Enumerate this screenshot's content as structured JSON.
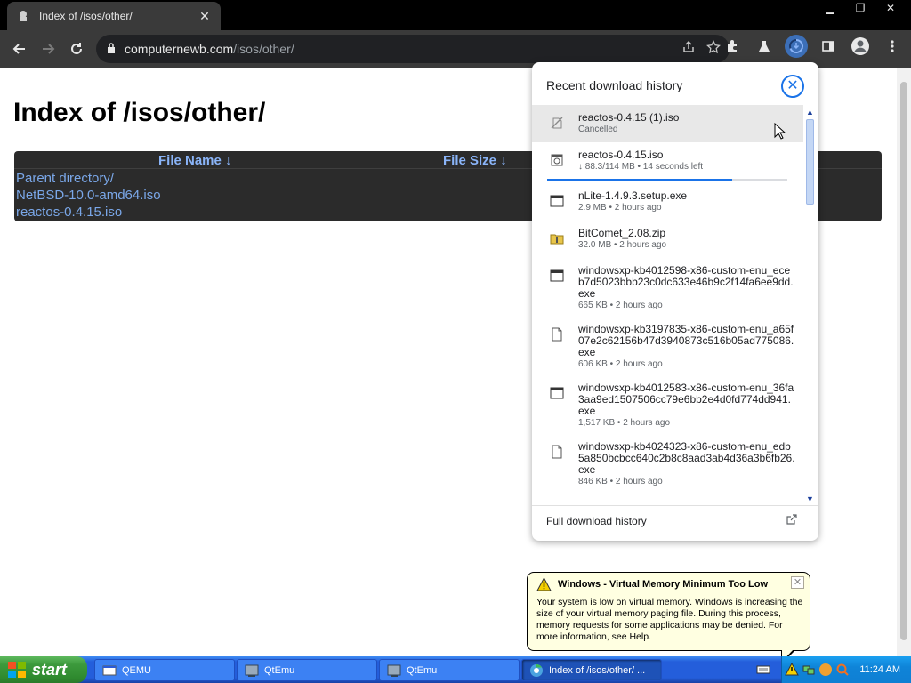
{
  "browser": {
    "tab_title": "Index of /isos/other/",
    "address_host": "computernewb.com",
    "address_path": "/isos/other/"
  },
  "page": {
    "heading": "Index of /isos/other/",
    "columns": [
      "File Name  ↓",
      "File Size  ↓"
    ],
    "entries": [
      "Parent directory/",
      "NetBSD-10.0-amd64.iso",
      "reactos-0.4.15.iso"
    ]
  },
  "downloads": {
    "title": "Recent download history",
    "footer": "Full download history",
    "items": [
      {
        "name": "reactos-0.4.15 (1).iso",
        "meta": "Cancelled",
        "icon": "cancelled-icon"
      },
      {
        "name": "reactos-0.4.15.iso",
        "meta": "↓ 88.3/114 MB • 14 seconds left",
        "icon": "disc-image-icon",
        "progress": 0.77
      },
      {
        "name": "nLite-1.4.9.3.setup.exe",
        "meta": "2.9 MB • 2 hours ago",
        "icon": "window-exe-icon"
      },
      {
        "name": "BitComet_2.08.zip",
        "meta": "32.0 MB • 2 hours ago",
        "icon": "zip-folder-icon"
      },
      {
        "name": "windowsxp-kb4012598-x86-custom-enu_eceb7d5023bbb23c0dc633e46b9c2f14fa6ee9dd.exe",
        "meta": "665 KB • 2 hours ago",
        "icon": "window-exe-icon"
      },
      {
        "name": "windowsxp-kb3197835-x86-custom-enu_a65f07e2c62156b47d3940873c516b05ad775086.exe",
        "meta": "606 KB • 2 hours ago",
        "icon": "file-icon"
      },
      {
        "name": "windowsxp-kb4012583-x86-custom-enu_36fa3aa9ed1507506cc79e6bb2e4d0fd774dd941.exe",
        "meta": "1,517 KB • 2 hours ago",
        "icon": "window-exe-icon"
      },
      {
        "name": "windowsxp-kb4024323-x86-custom-enu_edb5a850bcbcc640c2b8c8aad3ab4d36a3b6fb26.exe",
        "meta": "846 KB • 2 hours ago",
        "icon": "file-icon"
      }
    ]
  },
  "balloon": {
    "title": "Windows - Virtual Memory Minimum Too Low",
    "text": "Your system is low on virtual memory. Windows is increasing the size of your virtual memory paging file. During this process, memory requests for some applications may be denied. For more information, see Help."
  },
  "taskbar": {
    "start_label": "start",
    "buttons": [
      {
        "label": "QEMU",
        "icon": "qemu-window-icon"
      },
      {
        "label": "QtEmu",
        "icon": "qtemu-icon"
      },
      {
        "label": "QtEmu",
        "icon": "qtemu-icon"
      },
      {
        "label": "Index of /isos/other/ ...",
        "icon": "chrome-icon",
        "active": true
      }
    ],
    "clock": "11:24 AM"
  }
}
